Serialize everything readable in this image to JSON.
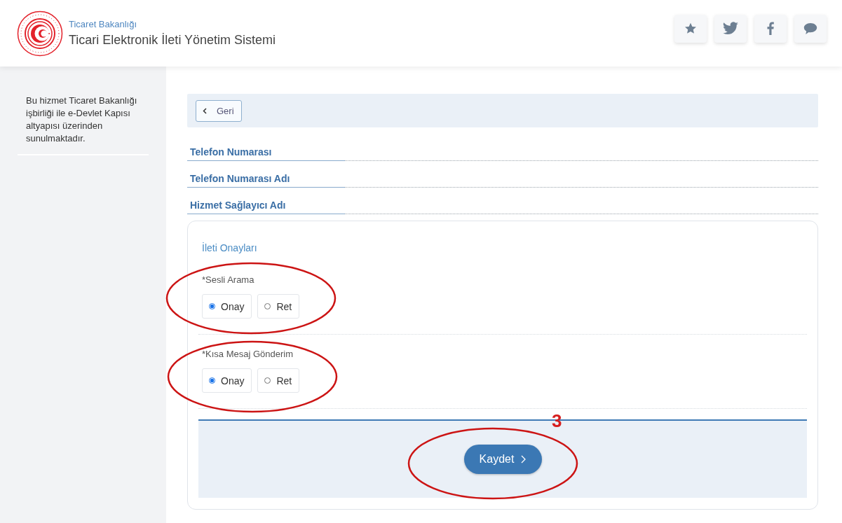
{
  "header": {
    "ministry": "Ticaret Bakanlığı",
    "system_title": "Ticari Elektronik İleti Yönetim Sistemi",
    "actions": [
      {
        "kind": "star"
      },
      {
        "kind": "twitter"
      },
      {
        "kind": "facebook"
      },
      {
        "kind": "chat"
      }
    ]
  },
  "sidebar": {
    "note": "Bu hizmet Ticaret Bakanlığı işbirliği ile e-Devlet Kapısı altyapısı üzerinden sunulmaktadır."
  },
  "back_button": {
    "label": "Geri"
  },
  "fields": [
    {
      "label": "Telefon Numarası"
    },
    {
      "label": "Telefon Numarası Adı"
    },
    {
      "label": "Hizmet Sağlayıcı Adı"
    }
  ],
  "form": {
    "title": "İleti Onayları",
    "groups": [
      {
        "label": "*Sesli Arama",
        "options": [
          {
            "label": "Onay",
            "selected": true
          },
          {
            "label": "Ret",
            "selected": false
          }
        ]
      },
      {
        "label": "*Kısa Mesaj Gönderim",
        "options": [
          {
            "label": "Onay",
            "selected": true
          },
          {
            "label": "Ret",
            "selected": false
          }
        ]
      }
    ],
    "save_button": "Kaydet"
  },
  "annotations": {
    "step_number": "3"
  }
}
